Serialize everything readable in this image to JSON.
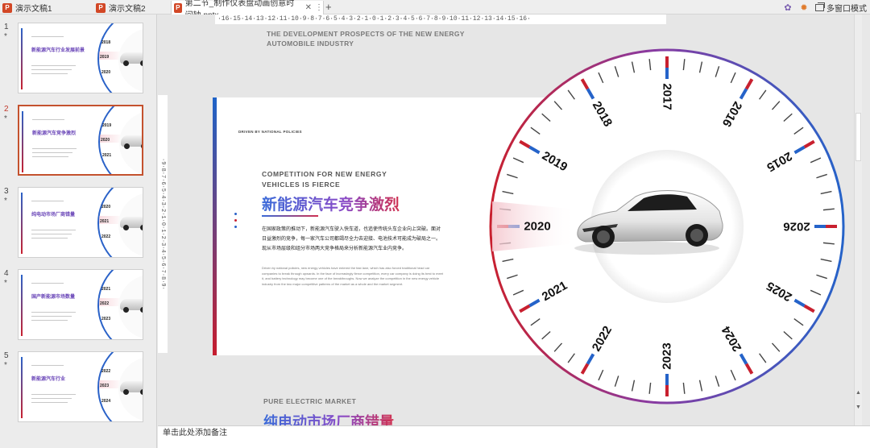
{
  "tabs": [
    {
      "label": "演示文稿1",
      "icon": "powerpoint-icon",
      "active": false
    },
    {
      "label": "演示文稿2",
      "icon": "powerpoint-icon",
      "active": false
    },
    {
      "label": "第二节_制作仪表盘动画创意时间轴.pptx",
      "icon": "powerpoint-icon",
      "active": true
    }
  ],
  "toolbar": {
    "multi_window_label": "多窗口模式",
    "new_tab": "+",
    "close": "✕",
    "menu": "⋮"
  },
  "thumbnails": [
    {
      "number": "1",
      "star": "*",
      "title": "新能源汽车行业发展前景",
      "year_a": "2019",
      "year_b": "2018",
      "year_c": "2020",
      "active": false
    },
    {
      "number": "2",
      "star": "*",
      "title": "新能源汽车竞争激烈",
      "year_a": "2020",
      "year_b": "2019",
      "year_c": "2021",
      "active": true
    },
    {
      "number": "3",
      "star": "*",
      "title": "纯电动市场厂商错量",
      "year_a": "2021",
      "year_b": "2020",
      "year_c": "2022",
      "active": false
    },
    {
      "number": "4",
      "star": "*",
      "title": "国产新能源市场数量",
      "year_a": "2022",
      "year_b": "2021",
      "year_c": "2023",
      "active": false
    },
    {
      "number": "5",
      "star": "*",
      "title": "新能源汽车行业",
      "year_a": "2023",
      "year_b": "2022",
      "year_c": "2024",
      "active": false
    }
  ],
  "ruler": {
    "horizontal": "·16·15·14·13·12·11·10·9·8·7·6·5·4·3·2·1·0·1·2·3·4·5·6·7·8·9·10·11·12·13·14·15·16·",
    "vertical": "·9·8·7·6·5·4·3·2·1·0·1·2·3·4·5·6·7·8·9·"
  },
  "above_slide_text": "THE DEVELOPMENT PROSPECTS OF THE NEW ENERGY AUTOMOBILE INDUSTRY",
  "slide": {
    "kicker": "DRIVEN BY NATIONAL POLICIES",
    "subtitle": "COMPETITION FOR NEW ENERGY VEHICLES IS FIERCE",
    "title": "新能源汽车竞争激烈",
    "cn_text": "在国家政策的推动下，新能源汽车驶入快车道，也追使传统头车企业向上突破。面对日益激烈的竞争，每一家汽车公司都竭尽全力去迎接、电池技术可能成为破局之一。现从市场层级和组分市场两大竞争格局来分析新能源汽车业内竞争。",
    "en_text": "Driven by national policies, new energy vehicles have entered the fast lane, which has also forced traditional head car companies to break through upwards. In the face of increasingly fierce competition, every car company is doing its best to meet it, and battery technology may become one of the breakthroughs. Now we analyze the competition in the new energy vehicle industry from the two major competitive patterns of the market as a whole and the market segment."
  },
  "wheel": {
    "years": [
      "2015",
      "2016",
      "2017",
      "2018",
      "2019",
      "2020",
      "2021",
      "2022",
      "2023",
      "2024",
      "2025",
      "2026"
    ],
    "highlight_year": "2020",
    "colors": {
      "blue": "#2563c9",
      "red": "#c8202f",
      "pink": "#f3c3cb"
    }
  },
  "below_slide": {
    "subtitle": "PURE ELECTRIC MARKET",
    "title": "纯电动市场厂商错量"
  },
  "notes": {
    "placeholder": "单击此处添加备注"
  }
}
